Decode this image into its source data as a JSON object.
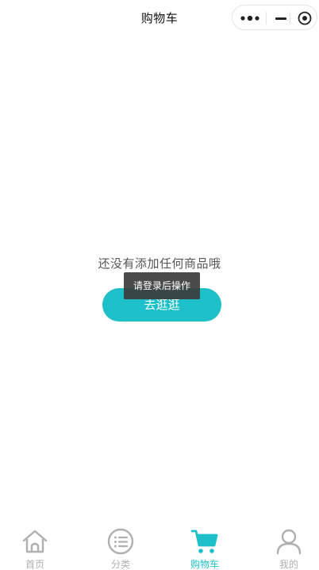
{
  "header": {
    "title": "购物车"
  },
  "empty": {
    "message": "还没有添加任何商品哦",
    "button_label": "去逛逛"
  },
  "toast": {
    "text": "请登录后操作"
  },
  "tabbar": {
    "tabs": [
      {
        "label": "首页",
        "icon": "home-icon",
        "active": false
      },
      {
        "label": "分类",
        "icon": "category-icon",
        "active": false
      },
      {
        "label": "购物车",
        "icon": "cart-icon",
        "active": true
      },
      {
        "label": "我的",
        "icon": "user-icon",
        "active": false
      }
    ]
  },
  "colors": {
    "accent": "#1dc0c8",
    "inactive": "#b0b0b0",
    "toast_bg": "#3c3c3c"
  }
}
